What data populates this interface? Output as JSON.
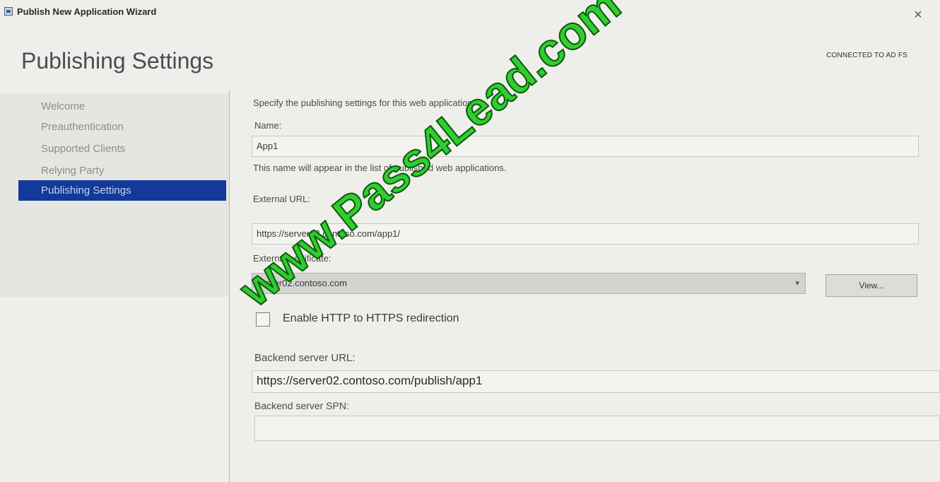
{
  "window": {
    "title": "Publish New Application Wizard",
    "close_glyph": "×"
  },
  "header": {
    "heading": "Publishing Settings",
    "connection_status": "CONNECTED TO AD FS"
  },
  "nav": {
    "items": [
      {
        "label": "Welcome"
      },
      {
        "label": "Preauthentication"
      },
      {
        "label": "Supported Clients"
      },
      {
        "label": "Relying Party"
      },
      {
        "label": "Publishing Settings",
        "active": true
      }
    ]
  },
  "form": {
    "intro": "Specify the publishing settings for this web application.",
    "name_label": "Name:",
    "name_value": "App1",
    "name_hint": "This name will appear in the list of published web applications.",
    "external_url_label": "External URL:",
    "external_url_value": "https://server02.contoso.com/app1/",
    "external_cert_label": "External certificate:",
    "external_cert_value": "server02.contoso.com",
    "view_button": "View...",
    "redirect_label": "Enable HTTP to HTTPS redirection",
    "redirect_checked": false,
    "backend_url_label": "Backend server URL:",
    "backend_url_value": "https://server02.contoso.com/publish/app1",
    "backend_spn_label": "Backend server SPN:",
    "backend_spn_value": ""
  },
  "watermark": "www.Pass4Lead.com",
  "colors": {
    "nav_active_bg": "#13399a",
    "watermark_green": "#28c828"
  }
}
